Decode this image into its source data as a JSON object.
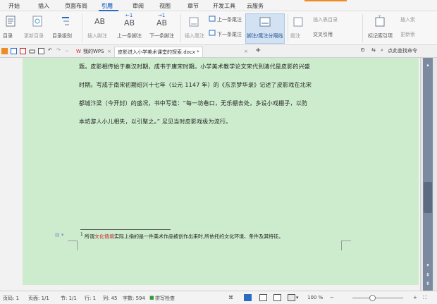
{
  "menu": {
    "items": [
      "开始",
      "插入",
      "页面布局",
      "引用",
      "审阅",
      "视图",
      "章节",
      "开发工具",
      "云服务"
    ],
    "active_index": 3
  },
  "ribbon": {
    "toc_label": "目录",
    "update_toc_label": "更新目录",
    "toc_level_label": "目录级别",
    "insert_footnote_label": "插入脚注",
    "prev_footnote_label": "上一条脚注",
    "next_footnote_label": "下一条脚注",
    "insert_endnote_label": "插入尾注",
    "prev_endnote_label": "上一条尾注",
    "next_endnote_label": "下一条尾注",
    "footnote_separator_label": "脚注/尾注分隔线",
    "caption_label": "题注",
    "insert_table_of_figures_label": "插入表目录",
    "cross_reference_label": "交叉引用",
    "mark_entry_label": "标记索引项",
    "insert_index_label": "插入索",
    "update_index_label": "更新索"
  },
  "tabs": {
    "mywps_label": "我的WPS",
    "doc_label": "皮影进入小学美术课堂的探索.docx *",
    "add_label": "+",
    "search_label": "点此查找命令"
  },
  "document": {
    "paragraph_lines": [
      "题。皮影相传始于秦汉时期，成书于唐宋时期。小学美术教学论文宋代到清代是皮影的兴盛",
      "时期。写成于南宋初期绍兴十七年（公元 1147 年）的《东京梦华录》记述了皮影戏在北宋",
      "都城汴梁（今开封）的盛况，书中写道：“每一坊巷口，无乐棚去处，多设小戏棚子，以防",
      "本坊游人小儿相失，以引聚之。” 足见当时皮影戏极为流行。"
    ],
    "footnote": {
      "marker": "1",
      "prefix": "所谓",
      "highlight": "文化情境",
      "suffix": "实际上指的是一件美术作品被创作出来时,所依托的文化环境、条件及其特征。"
    }
  },
  "status": {
    "page_number": "页码: 1",
    "pages": "页面: 1/1",
    "section": "节: 1/1",
    "row": "行: 1",
    "column": "列: 45",
    "word_count": "字数: 594",
    "spellcheck": "拼写检查",
    "zoom": "100 %",
    "zoom_fraction": 0.4
  },
  "colors": {
    "page_bg": "#cdeccd",
    "accent": "#2b6cc2",
    "footnote_highlight": "#c0262d"
  }
}
